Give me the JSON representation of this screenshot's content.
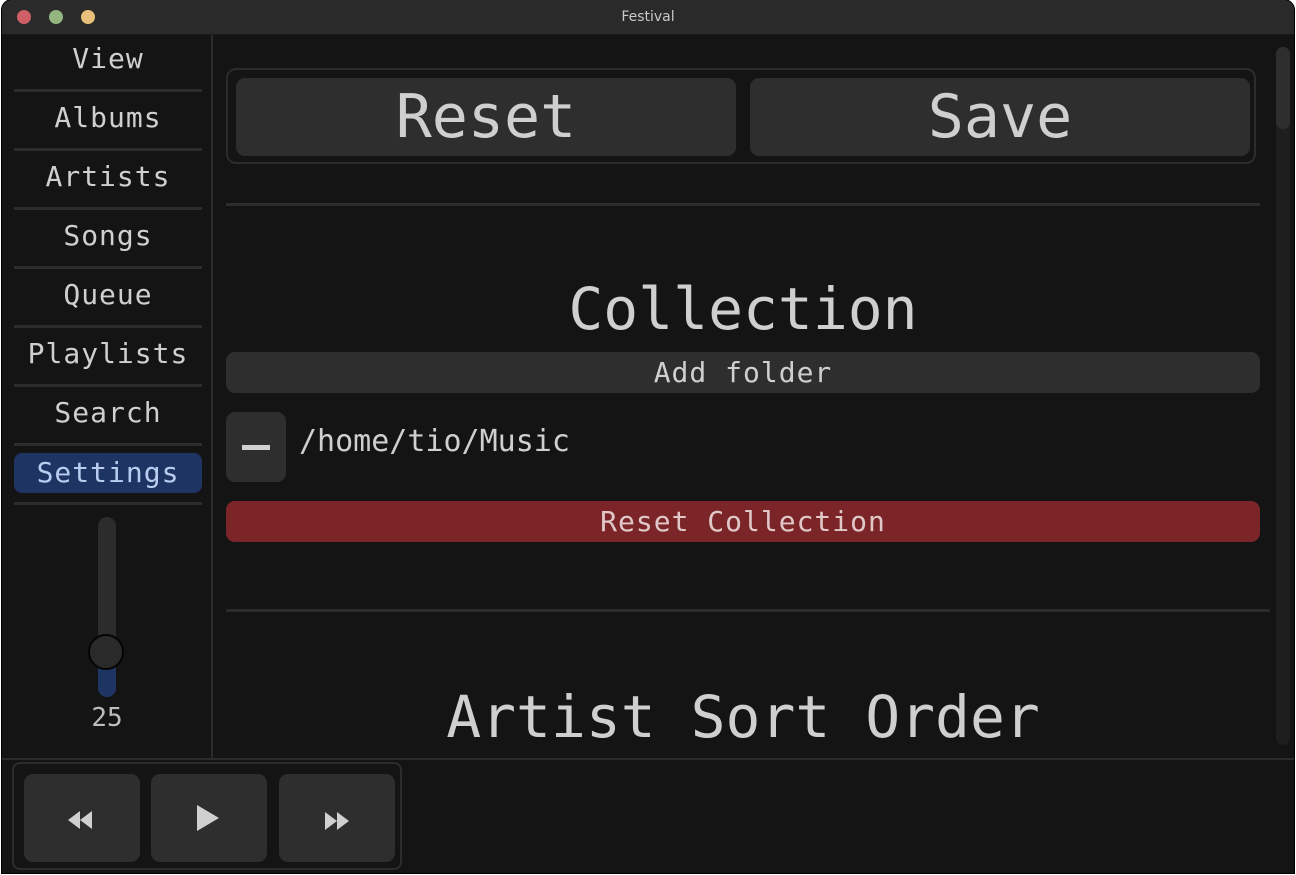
{
  "window": {
    "title": "Festival"
  },
  "sidebar": {
    "items": [
      {
        "label": "View",
        "active": false
      },
      {
        "label": "Albums",
        "active": false
      },
      {
        "label": "Artists",
        "active": false
      },
      {
        "label": "Songs",
        "active": false
      },
      {
        "label": "Queue",
        "active": false
      },
      {
        "label": "Playlists",
        "active": false
      },
      {
        "label": "Search",
        "active": false
      },
      {
        "label": "Settings",
        "active": true
      }
    ],
    "volume": {
      "value": "25",
      "level": 0.25
    }
  },
  "settings": {
    "reset_label": "Reset",
    "save_label": "Save",
    "collection": {
      "title": "Collection",
      "add_folder_label": "Add folder",
      "folders": [
        "/home/tio/Music"
      ],
      "reset_collection_label": "Reset Collection"
    },
    "artist_sort_order": {
      "title": "Artist Sort Order"
    }
  },
  "transport": {
    "previous_icon": "rewind-icon",
    "play_icon": "play-icon",
    "next_icon": "fast-forward-icon"
  },
  "colors": {
    "background": "#141414",
    "button": "#2e2e2e",
    "accent": "#1e3463",
    "danger": "#7b2528",
    "text": "#cfcfcf"
  }
}
